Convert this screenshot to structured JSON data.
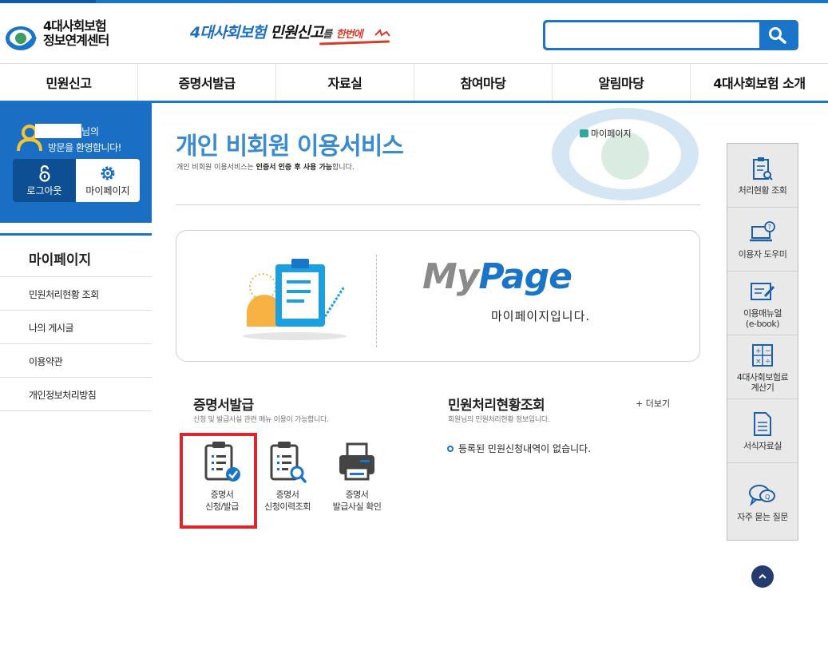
{
  "header": {
    "logo_line1": "4대사회보험",
    "logo_line2": "정보연계센터",
    "slogan_part1": "4대사회보험",
    "slogan_part2": "민원신고",
    "slogan_part3": "를",
    "slogan_part4": "한번에",
    "search_value": "",
    "search_icon": "search-icon"
  },
  "nav": [
    "민원신고",
    "증명서발급",
    "자료실",
    "참여마당",
    "알림마당",
    "4대사회보험 소개"
  ],
  "welcome": {
    "suffix": "님의",
    "message": "방문을 환영합니다!",
    "logout": "로그아웃",
    "mypage": "마이페이지"
  },
  "side": {
    "title": "마이페이지",
    "items": [
      "민원처리현황 조회",
      "나의 게시글",
      "이용약관",
      "개인정보처리방침"
    ]
  },
  "main": {
    "title": "개인 비회원 이용서비스",
    "desc_part1": "개인 비회원 이용서비스는 ",
    "desc_bold": "인증서 인증 후 사용 가능",
    "desc_part2": "합니다.",
    "breadcrumb": "마이페이지",
    "mypage_logo_my": "My",
    "mypage_logo_page": "Page",
    "mypage_text": "마이페이지입니다."
  },
  "cert": {
    "title": "증명서발급",
    "desc": "신청 및 발급사실 관련 메뉴 이용이 가능합니다.",
    "items": [
      {
        "line1": "증명서",
        "line2": "신청/발급"
      },
      {
        "line1": "증명서",
        "line2": "신청이력조회"
      },
      {
        "line1": "증명서",
        "line2": "발급사실 확인"
      }
    ]
  },
  "status": {
    "title": "민원처리현황조회",
    "desc": "회원님의 민원처리현황 정보입니다.",
    "more": "+ 더보기",
    "empty": "등록된 민원신청내역이 없습니다."
  },
  "quick": [
    {
      "line1": "처리현황 조회",
      "line2": ""
    },
    {
      "line1": "이용자 도우미",
      "line2": ""
    },
    {
      "line1": "이용매뉴얼",
      "line2": "(e-book)"
    },
    {
      "line1": "4대사회보험료",
      "line2": "계산기"
    },
    {
      "line1": "서식자료실",
      "line2": ""
    },
    {
      "line1": "자주 묻는 질문",
      "line2": ""
    }
  ],
  "colors": {
    "brand": "#1a74c7",
    "highlight": "#e0242b",
    "accent_red": "#d93b2a"
  }
}
